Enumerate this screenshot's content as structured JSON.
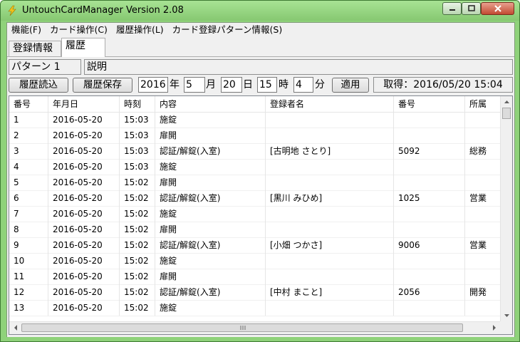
{
  "window": {
    "title": "UntouchCardManager  Version 2.08",
    "accent_color": "#8fd27a"
  },
  "menu": [
    "機能(F)",
    "カード操作(C)",
    "履歴操作(L)",
    "カード登録パターン情報(S)"
  ],
  "tabs": [
    {
      "label": "登録情報",
      "active": false
    },
    {
      "label": "履歴",
      "active": true
    }
  ],
  "pattern": {
    "name": "パターン 1",
    "description": "説明"
  },
  "toolbar": {
    "load_label": "履歴読込",
    "save_label": "履歴保存",
    "year": "2016",
    "year_unit": "年",
    "month": "5",
    "month_unit": "月",
    "day": "20",
    "day_unit": "日",
    "hour": "15",
    "hour_unit": "時",
    "minute": "4",
    "minute_unit": "分",
    "apply_label": "適用",
    "acquired": "取得：2016/05/20 15:04"
  },
  "table": {
    "columns": [
      "番号",
      "年月日",
      "時刻",
      "内容",
      "登録者名",
      "番号",
      "所属"
    ],
    "rows": [
      [
        "1",
        "2016-05-20",
        "15:03",
        "施錠",
        "",
        "",
        ""
      ],
      [
        "2",
        "2016-05-20",
        "15:03",
        "扉開",
        "",
        "",
        ""
      ],
      [
        "3",
        "2016-05-20",
        "15:03",
        "認証/解錠(入室)",
        "[古明地 さとり]",
        "5092",
        "総務"
      ],
      [
        "4",
        "2016-05-20",
        "15:03",
        "施錠",
        "",
        "",
        ""
      ],
      [
        "5",
        "2016-05-20",
        "15:02",
        "扉開",
        "",
        "",
        ""
      ],
      [
        "6",
        "2016-05-20",
        "15:02",
        "認証/解錠(入室)",
        "[黒川 みひめ]",
        "1025",
        "営業"
      ],
      [
        "7",
        "2016-05-20",
        "15:02",
        "施錠",
        "",
        "",
        ""
      ],
      [
        "8",
        "2016-05-20",
        "15:02",
        "扉開",
        "",
        "",
        ""
      ],
      [
        "9",
        "2016-05-20",
        "15:02",
        "認証/解錠(入室)",
        "[小畑 つかさ]",
        "9006",
        "営業"
      ],
      [
        "10",
        "2016-05-20",
        "15:02",
        "施錠",
        "",
        "",
        ""
      ],
      [
        "11",
        "2016-05-20",
        "15:02",
        "扉開",
        "",
        "",
        ""
      ],
      [
        "12",
        "2016-05-20",
        "15:02",
        "認証/解錠(入室)",
        "[中村 まこと]",
        "2056",
        "開発"
      ],
      [
        "13",
        "2016-05-20",
        "15:02",
        "施錠",
        "",
        "",
        ""
      ]
    ]
  }
}
